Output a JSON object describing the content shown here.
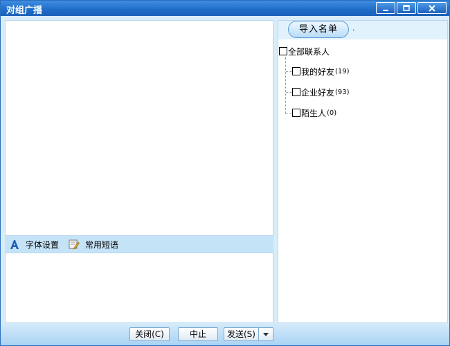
{
  "window": {
    "title": "对组广播"
  },
  "toolbar": {
    "font_label": "字体设置",
    "phrases_label": "常用短语"
  },
  "contacts": {
    "import_label": "导入名单",
    "import_dot": "·",
    "root": {
      "label": "全部联系人"
    },
    "groups": [
      {
        "label": "我的好友",
        "count": "(19)"
      },
      {
        "label": "企业好友",
        "count": "(93)"
      },
      {
        "label": "陌生人",
        "count": "(0)"
      }
    ]
  },
  "footer": {
    "close_label": "关闭(C)",
    "stop_label": "中止",
    "send_label": "发送(S)"
  }
}
